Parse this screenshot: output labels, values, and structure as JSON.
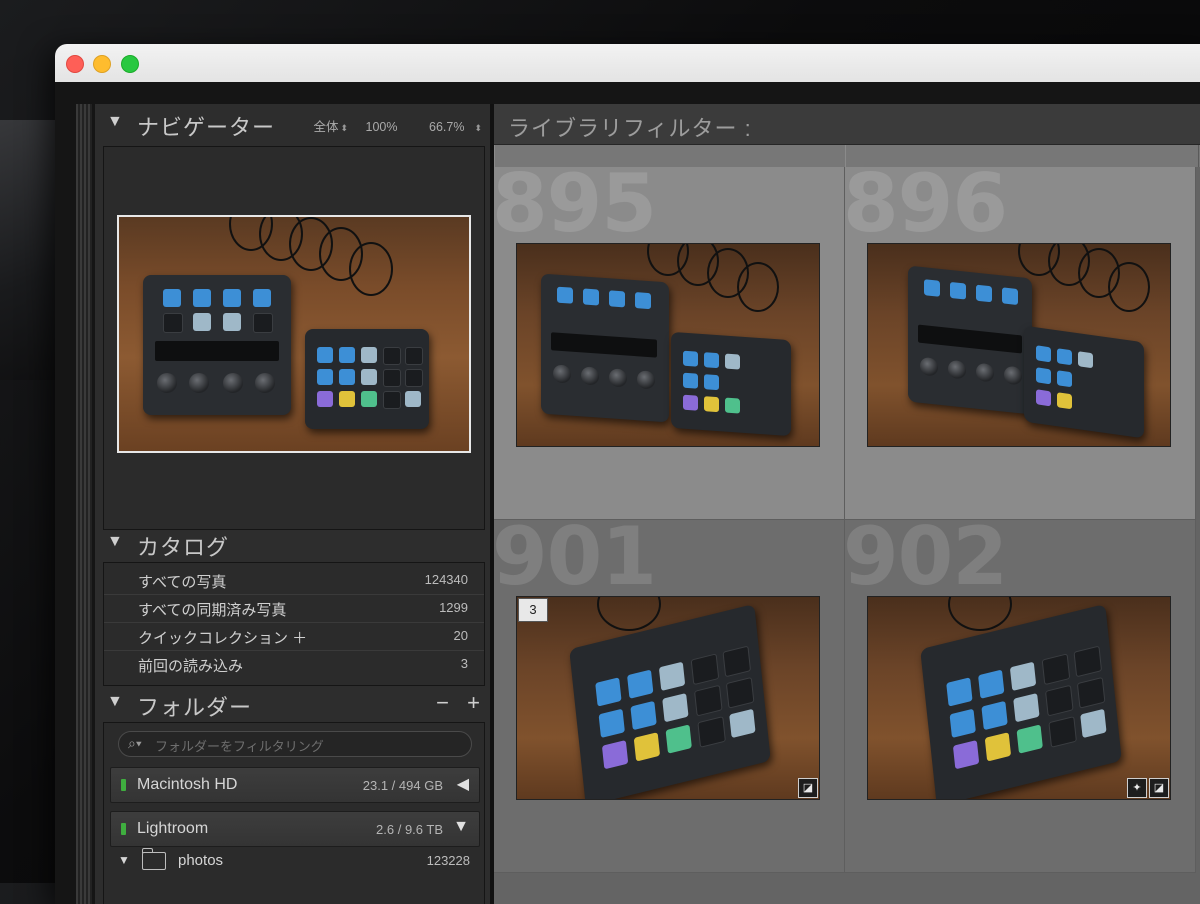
{
  "window": {
    "controls": [
      "close",
      "minimize",
      "maximize"
    ]
  },
  "navigator": {
    "title": "ナビゲーター",
    "fit_option": "全体",
    "zoom_100": "100%",
    "zoom_custom": "66.7%"
  },
  "catalog": {
    "title": "カタログ",
    "items": [
      {
        "label": "すべての写真",
        "count": "124340"
      },
      {
        "label": "すべての同期済み写真",
        "count": "1299"
      },
      {
        "label": "クイックコレクション ＋",
        "count": "20"
      },
      {
        "label": "前回の読み込み",
        "count": "3"
      }
    ]
  },
  "folders": {
    "title": "フォルダー",
    "remove_label": "−",
    "add_label": "+",
    "search_placeholder": "フォルダーをフィルタリング",
    "volumes": [
      {
        "name": "Macintosh HD",
        "size": "23.1 / 494 GB",
        "state": "collapsed"
      },
      {
        "name": "Lightroom",
        "size": "2.6 / 9.6 TB",
        "state": "expanded"
      }
    ],
    "subfolder": {
      "name": "photos",
      "count": "123228"
    }
  },
  "library_filter": {
    "title": "ライブラリフィルター :"
  },
  "grid": {
    "cells": [
      {
        "index": "895",
        "badge": "",
        "icons": []
      },
      {
        "index": "896",
        "badge": "",
        "icons": []
      },
      {
        "index": "901",
        "badge": "3",
        "icons": [
          "develop-icon"
        ]
      },
      {
        "index": "902",
        "badge": "",
        "icons": [
          "ai-edit-icon",
          "develop-icon"
        ]
      }
    ]
  },
  "colors": {
    "led_green": "#3fae3f",
    "grid_background": "#646464",
    "cell_background": "#8b8b8b",
    "panel_background": "#2d2d2d"
  }
}
